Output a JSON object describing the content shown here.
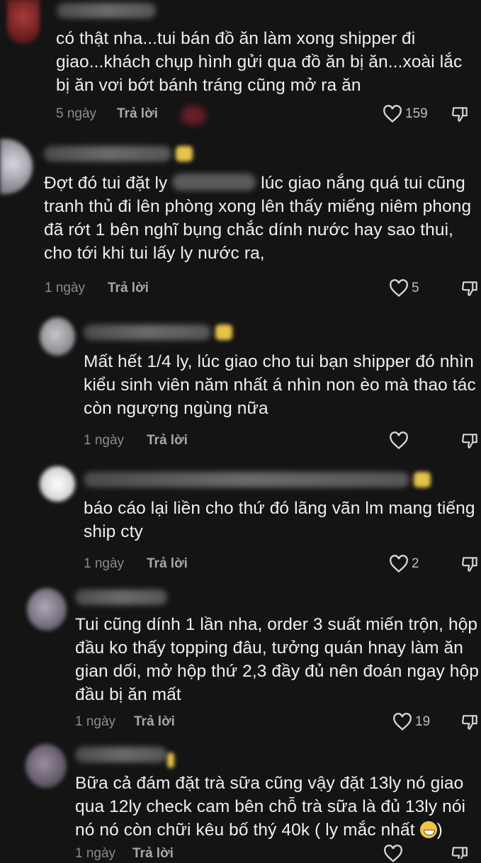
{
  "comments": [
    {
      "text": "có thật nha...tui bán đồ ăn làm xong shipper đi giao...khách chụp hình gửi qua đồ ăn bị ăn...xoài lắc bị ăn vơi bớt bánh tráng cũng mở ra ăn",
      "time": "5 ngày",
      "reply": "Trả lời",
      "likes": "159"
    },
    {
      "text_before": "Đợt đó tui đặt ly ",
      "text_after": " lúc giao nắng quá tui cũng tranh thủ đi lên phòng xong lên thấy miếng niêm phong đã rớt 1 bên nghĩ bụng chắc dính nước hay sao thui, cho tới khi tui lấy ly nước ra,",
      "time": "1 ngày",
      "reply": "Trả lời",
      "likes": "5"
    },
    {
      "text": "Mất hết 1/4 ly, lúc giao cho tui bạn shipper đó nhìn kiểu sinh viên năm nhất á nhìn non èo mà thao tác còn ngượng ngùng nữa",
      "time": "1 ngày",
      "reply": "Trả lời",
      "likes": ""
    },
    {
      "text": "báo cáo lại liền cho thứ đó lãng vãn lm mang tiếng ship cty",
      "time": "1 ngày",
      "reply": "Trả lời",
      "likes": "2"
    },
    {
      "text": "Tui cũng dính 1 lần nha, order 3 suất miến trộn, hộp đầu ko thấy topping đâu, tưởng quán hnay làm ăn gian dối, mở hộp thứ 2,3 đầy đủ nên đoán ngay hộp đầu bị ăn mất",
      "time": "1 ngày",
      "reply": "Trả lời",
      "likes": "19"
    },
    {
      "text": "Bữa cả đám đặt trà sữa cũng vậy đặt 13ly nó giao qua 12ly check cam bên chỗ trà sữa là đủ 13ly nói nó nó còn chữi kêu bố thý 40k ( ly mắc nhất ",
      "text_end": ")",
      "time": "1 ngày",
      "reply": "Trả lời",
      "likes": ""
    }
  ],
  "icons": {
    "like": "heart-outline-icon",
    "dislike": "thumbs-down-icon",
    "emoji": "grinning-face-emoji"
  },
  "colors": {
    "background": "#141414",
    "text": "#efefef",
    "meta": "#8c8c8c"
  }
}
